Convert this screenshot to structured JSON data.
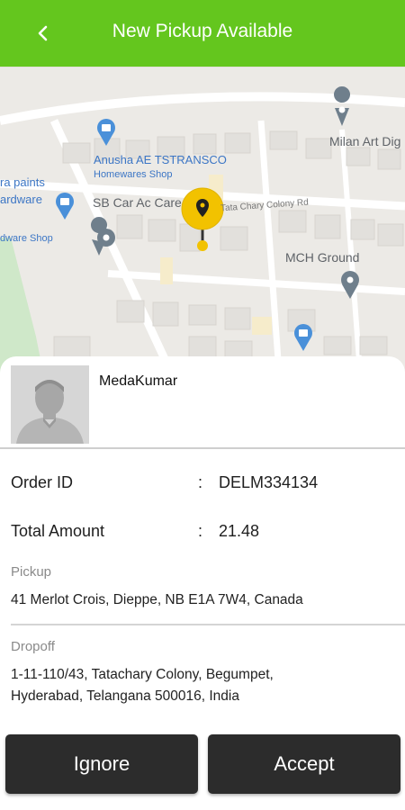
{
  "header": {
    "title": "New Pickup Available",
    "background": "#64c61e"
  },
  "map": {
    "labels": {
      "anusha": "Anusha AE TSTRANSCO",
      "anusha_sub": "Homewares Shop",
      "milan": "Milan Art Dig",
      "sb_car": "SB Car Ac Care",
      "road": "Tata Chary Colony Rd",
      "ra_paints": "ra paints",
      "hardware": "ardware",
      "hardware_shop": "dware Shop",
      "mch": "MCH Ground"
    },
    "marker_color": "#f2c200"
  },
  "driver": {
    "name": "MedaKumar"
  },
  "order": {
    "id_label": "Order ID",
    "colon": ":",
    "id_value": "DELM334134",
    "amount_label": "Total Amount",
    "amount_value": "21.48"
  },
  "pickup": {
    "title": "Pickup",
    "address": "41 Merlot Crois, Dieppe, NB E1A 7W4, Canada"
  },
  "dropoff": {
    "title": "Dropoff",
    "address_line1": "1-11-110/43, Tatachary Colony, Begumpet,",
    "address_line2": "Hyderabad, Telangana 500016, India"
  },
  "actions": {
    "ignore_label": "Ignore",
    "accept_label": "Accept"
  }
}
